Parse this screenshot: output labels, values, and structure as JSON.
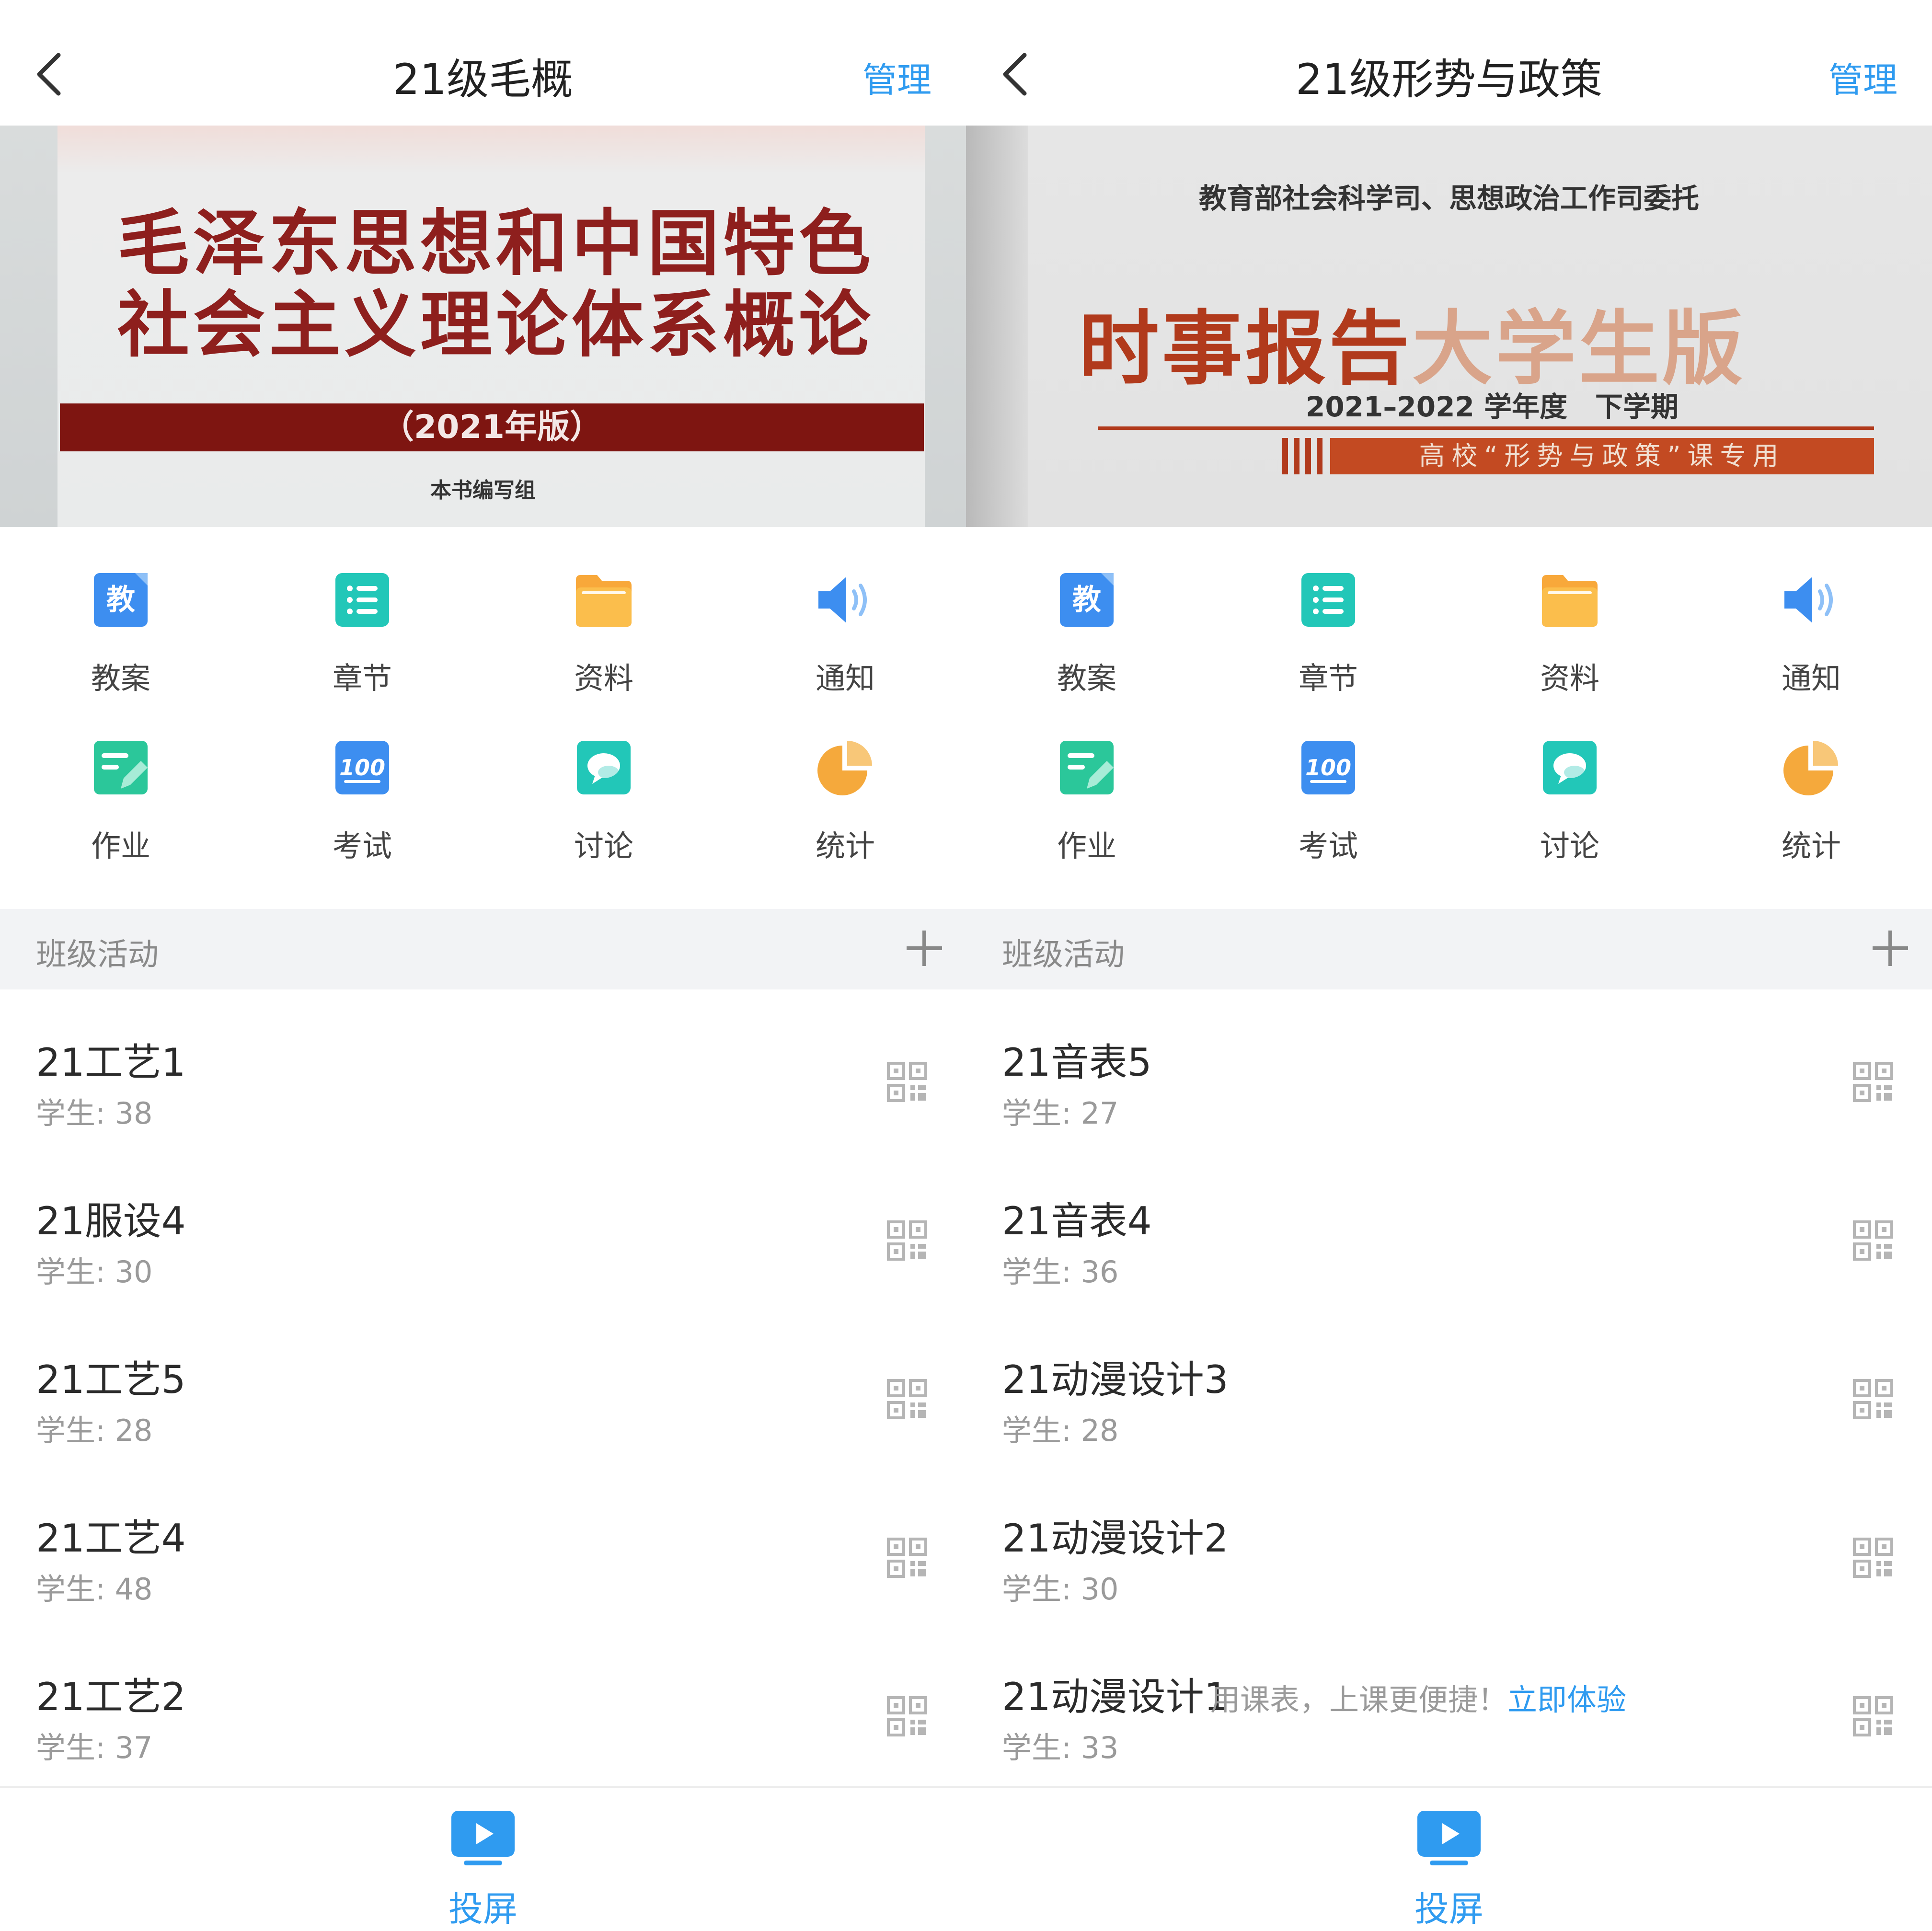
{
  "colors": {
    "accent": "#2f9bf0"
  },
  "panels": [
    {
      "header": {
        "title": "21级毛概",
        "manage_label": "管理",
        "back_icon": "chevron-left-icon"
      },
      "cover": {
        "line1": "毛泽东思想和中国特色",
        "line2": "社会主义理论体系概论",
        "edition": "（2021年版）",
        "author": "本书编写组"
      },
      "features": [
        {
          "label": "教案",
          "icon": "lesson-plan-icon"
        },
        {
          "label": "章节",
          "icon": "chapter-list-icon"
        },
        {
          "label": "资料",
          "icon": "folder-icon"
        },
        {
          "label": "通知",
          "icon": "speaker-icon"
        },
        {
          "label": "作业",
          "icon": "homework-icon"
        },
        {
          "label": "考试",
          "icon": "exam-100-icon"
        },
        {
          "label": "讨论",
          "icon": "discussion-icon"
        },
        {
          "label": "统计",
          "icon": "pie-chart-icon"
        }
      ],
      "section": {
        "label": "班级活动",
        "add_icon": "plus-icon"
      },
      "classes": [
        {
          "name": "21工艺1",
          "count": "学生: 38"
        },
        {
          "name": "21服设4",
          "count": "学生: 30"
        },
        {
          "name": "21工艺5",
          "count": "学生: 28"
        },
        {
          "name": "21工艺4",
          "count": "学生: 48"
        },
        {
          "name": "21工艺2",
          "count": "学生: 37"
        }
      ],
      "bottom": {
        "label": "投屏",
        "icon": "screen-cast-icon"
      }
    },
    {
      "header": {
        "title": "21级形势与政策",
        "manage_label": "管理",
        "back_icon": "chevron-left-icon"
      },
      "cover": {
        "top_line": "教育部社会科学司、思想政治工作司委托",
        "main_a": "时事报告",
        "main_b": "大学生版",
        "year": "2021–2022 学年度　下学期",
        "tag": "高校“形势与政策”课专用"
      },
      "features": [
        {
          "label": "教案",
          "icon": "lesson-plan-icon"
        },
        {
          "label": "章节",
          "icon": "chapter-list-icon"
        },
        {
          "label": "资料",
          "icon": "folder-icon"
        },
        {
          "label": "通知",
          "icon": "speaker-icon"
        },
        {
          "label": "作业",
          "icon": "homework-icon"
        },
        {
          "label": "考试",
          "icon": "exam-100-icon"
        },
        {
          "label": "讨论",
          "icon": "discussion-icon"
        },
        {
          "label": "统计",
          "icon": "pie-chart-icon"
        }
      ],
      "section": {
        "label": "班级活动",
        "add_icon": "plus-icon"
      },
      "classes": [
        {
          "name": "21音表5",
          "count": "学生: 27"
        },
        {
          "name": "21音表4",
          "count": "学生: 36"
        },
        {
          "name": "21动漫设计3",
          "count": "学生: 28"
        },
        {
          "name": "21动漫设计2",
          "count": "学生: 30"
        },
        {
          "name": "21动漫设计1",
          "count": "学生: 33"
        }
      ],
      "promo": {
        "text": "用课表，上课更便捷！",
        "link": "立即体验"
      },
      "bottom": {
        "label": "投屏",
        "icon": "screen-cast-icon"
      }
    }
  ]
}
